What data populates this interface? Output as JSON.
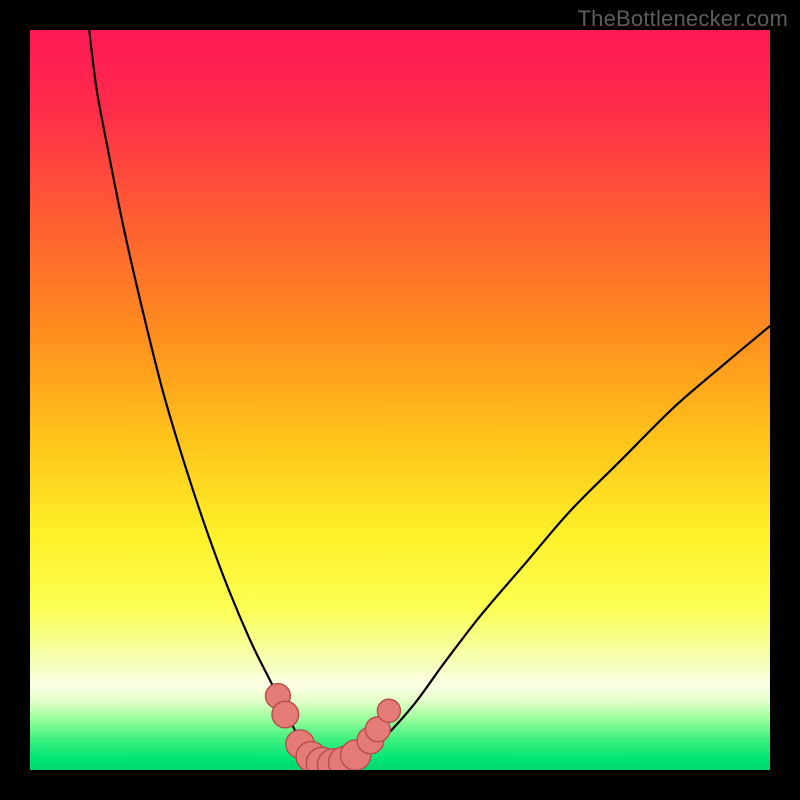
{
  "watermark": "TheBottlenecker.com",
  "chart_data": {
    "type": "line",
    "title": "",
    "xlabel": "",
    "ylabel": "",
    "xlim": [
      0,
      100
    ],
    "ylim": [
      0,
      100
    ],
    "gradient_stops": [
      {
        "offset": 0.0,
        "color": "#ff1a56"
      },
      {
        "offset": 0.1,
        "color": "#ff2a4b"
      },
      {
        "offset": 0.25,
        "color": "#ff5c33"
      },
      {
        "offset": 0.4,
        "color": "#ff8a1f"
      },
      {
        "offset": 0.55,
        "color": "#ffc21a"
      },
      {
        "offset": 0.68,
        "color": "#fff029"
      },
      {
        "offset": 0.78,
        "color": "#fbff52"
      },
      {
        "offset": 0.85,
        "color": "#f6ffb1"
      },
      {
        "offset": 0.885,
        "color": "#fcffe6"
      },
      {
        "offset": 0.905,
        "color": "#e6ffcb"
      },
      {
        "offset": 0.93,
        "color": "#9cff9e"
      },
      {
        "offset": 0.96,
        "color": "#3bf07d"
      },
      {
        "offset": 0.985,
        "color": "#00e576"
      },
      {
        "offset": 1.0,
        "color": "#00d56e"
      }
    ],
    "series": [
      {
        "name": "bottleneck-curve",
        "x": [
          8.0,
          9.0,
          10.5,
          12.5,
          15.0,
          18.0,
          21.0,
          24.0,
          27.0,
          30.0,
          32.5,
          34.5,
          36.0,
          37.5,
          39.0,
          40.5,
          42.5,
          45.0,
          48.0,
          52.0,
          56.0,
          61.0,
          67.0,
          73.0,
          80.0,
          87.0,
          94.0,
          100.0
        ],
        "y": [
          100.0,
          92.0,
          84.0,
          74.0,
          63.0,
          51.0,
          41.0,
          32.0,
          24.0,
          17.0,
          12.0,
          8.0,
          5.0,
          2.7,
          1.2,
          0.4,
          0.6,
          1.8,
          4.5,
          9.0,
          14.5,
          21.0,
          28.0,
          35.0,
          42.0,
          49.0,
          55.0,
          60.0
        ]
      }
    ],
    "markers": {
      "name": "highlight-markers",
      "fill": "#e47b77",
      "stroke": "#b54d49",
      "points": [
        {
          "x": 33.5,
          "y": 10.0,
          "r": 1.4
        },
        {
          "x": 34.5,
          "y": 7.5,
          "r": 1.5
        },
        {
          "x": 36.5,
          "y": 3.5,
          "r": 1.6
        },
        {
          "x": 38.0,
          "y": 1.8,
          "r": 1.7
        },
        {
          "x": 39.5,
          "y": 0.9,
          "r": 1.8
        },
        {
          "x": 41.0,
          "y": 0.7,
          "r": 1.8
        },
        {
          "x": 42.5,
          "y": 1.0,
          "r": 1.8
        },
        {
          "x": 44.0,
          "y": 2.0,
          "r": 1.7
        },
        {
          "x": 46.0,
          "y": 4.0,
          "r": 1.5
        },
        {
          "x": 47.0,
          "y": 5.5,
          "r": 1.4
        },
        {
          "x": 48.5,
          "y": 8.0,
          "r": 1.3
        }
      ]
    }
  }
}
